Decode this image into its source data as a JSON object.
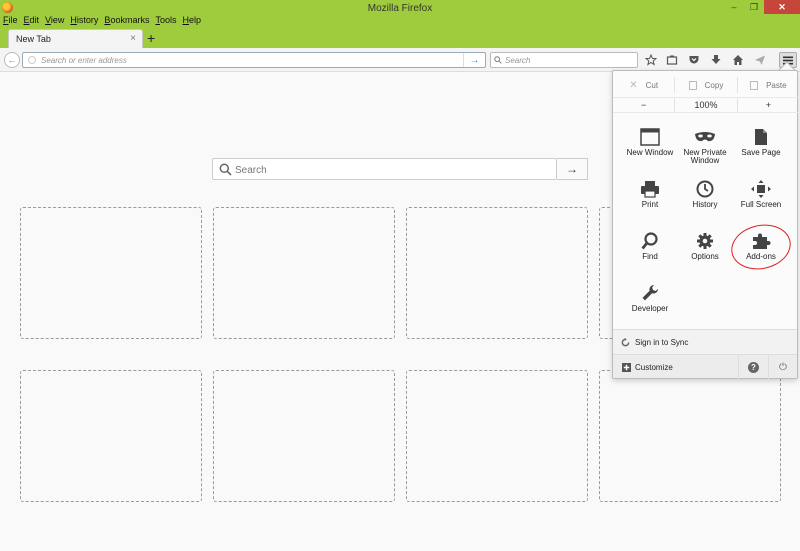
{
  "window": {
    "title": "Mozilla Firefox",
    "minimize": "–",
    "restore": "❐",
    "close": "✕"
  },
  "menubar": {
    "items": [
      {
        "key": "F",
        "rest": "ile"
      },
      {
        "key": "E",
        "rest": "dit"
      },
      {
        "key": "V",
        "rest": "iew"
      },
      {
        "key": "H",
        "rest": "istory"
      },
      {
        "key": "B",
        "rest": "ookmarks"
      },
      {
        "key": "T",
        "rest": "ools"
      },
      {
        "key": "H",
        "rest": "elp"
      }
    ]
  },
  "tabs": {
    "active_label": "New Tab",
    "close": "×",
    "new_tab": "+"
  },
  "navbar": {
    "url_placeholder": "Search or enter address",
    "search_placeholder": "Search",
    "go": "→",
    "back": "←"
  },
  "content": {
    "search_placeholder": "Search",
    "search_go": "→"
  },
  "panel": {
    "edit": {
      "cut": "Cut",
      "copy": "Copy",
      "paste": "Paste"
    },
    "zoom": {
      "minus": "−",
      "level": "100%",
      "plus": "+"
    },
    "items": {
      "new_window": "New Window",
      "new_private_window": "New Private Window",
      "save_page": "Save Page",
      "print": "Print",
      "history": "History",
      "full_screen": "Full Screen",
      "find": "Find",
      "options": "Options",
      "add_ons": "Add-ons",
      "developer": "Developer"
    },
    "sync": "Sign in to Sync",
    "customize": "Customize",
    "help": "?",
    "quit": "⏻"
  },
  "colors": {
    "titlebar": "#9fcc3c",
    "annotation_ring": "#dd2222",
    "go_arrow": "#3a8ad6"
  }
}
